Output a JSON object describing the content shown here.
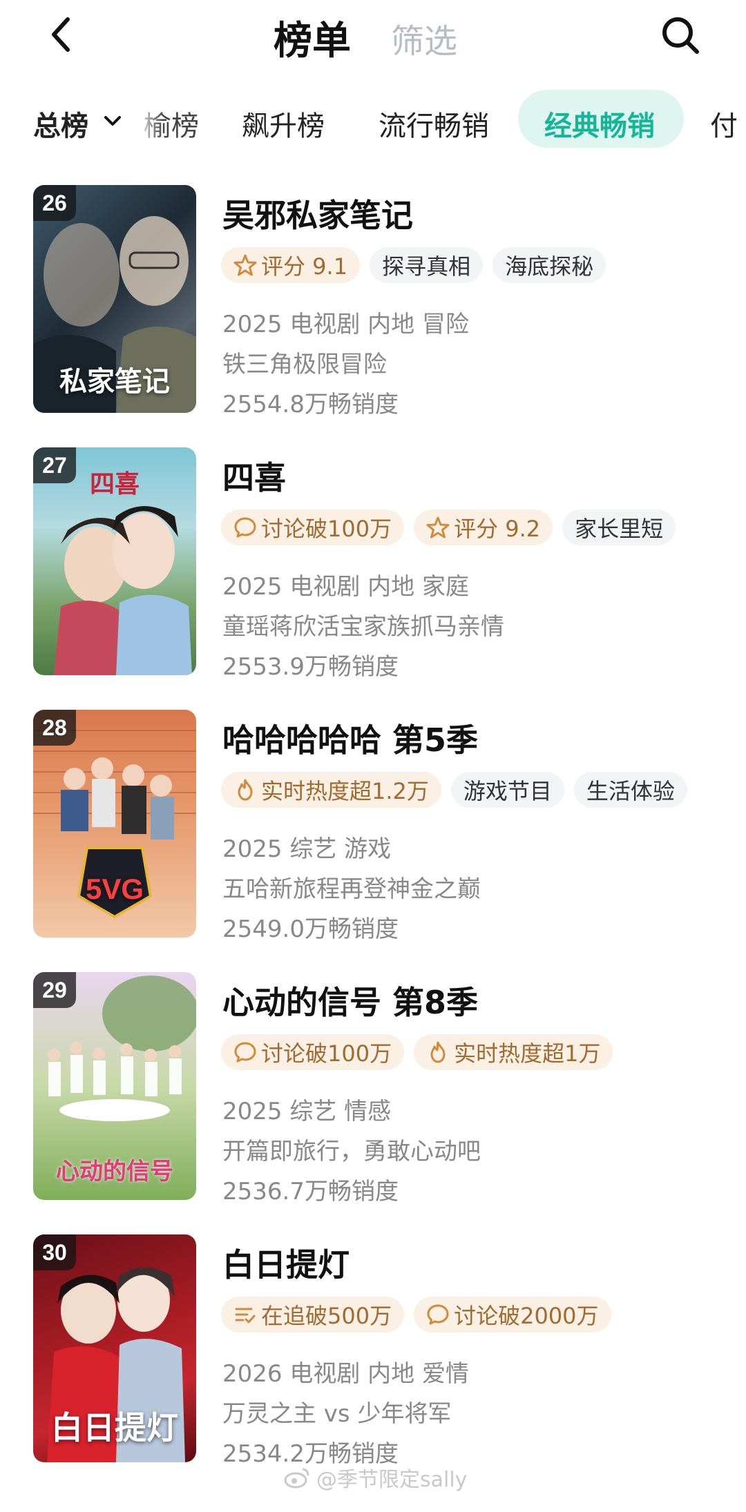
{
  "header": {
    "title": "榜单",
    "filter_label": "筛选"
  },
  "tabs": {
    "total_label": "总榜",
    "items": [
      "榆榜",
      "飙升榜",
      "流行畅销",
      "经典畅销",
      "付"
    ],
    "active_index": 3
  },
  "colors": {
    "accent": "#15b59a",
    "tag_highlight_bg": "#fbf0e4",
    "tag_highlight_text": "#a06a30"
  },
  "list": [
    {
      "rank": "26",
      "title": "吴邪私家笔记",
      "tags": [
        {
          "icon": "star-icon",
          "text": "评分 9.1",
          "style": "hl"
        },
        {
          "icon": "",
          "text": "探寻真相",
          "style": "gray"
        },
        {
          "icon": "",
          "text": "海底探秘",
          "style": "gray"
        }
      ],
      "meta": "2025 电视剧 内地 冒险",
      "desc": "铁三角极限冒险",
      "sales": "2554.8万畅销度",
      "poster_text": "私家笔记"
    },
    {
      "rank": "27",
      "title": "四喜",
      "tags": [
        {
          "icon": "comment-icon",
          "text": "讨论破100万",
          "style": "hl"
        },
        {
          "icon": "star-icon",
          "text": "评分 9.2",
          "style": "hl"
        },
        {
          "icon": "",
          "text": "家长里短",
          "style": "gray"
        }
      ],
      "meta": "2025 电视剧 内地 家庭",
      "desc": "童瑶蒋欣活宝家族抓马亲情",
      "sales": "2553.9万畅销度",
      "poster_text": "四喜"
    },
    {
      "rank": "28",
      "title": "哈哈哈哈哈 第5季",
      "tags": [
        {
          "icon": "flame-icon",
          "text": "实时热度超1.2万",
          "style": "hl"
        },
        {
          "icon": "",
          "text": "游戏节目",
          "style": "gray"
        },
        {
          "icon": "",
          "text": "生活体验",
          "style": "gray"
        }
      ],
      "meta": "2025 综艺 游戏",
      "desc": "五哈新旅程再登神金之巅",
      "sales": "2549.0万畅销度",
      "poster_text": "5VG"
    },
    {
      "rank": "29",
      "title": "心动的信号 第8季",
      "tags": [
        {
          "icon": "comment-icon",
          "text": "讨论破100万",
          "style": "hl"
        },
        {
          "icon": "flame-icon",
          "text": "实时热度超1万",
          "style": "hl"
        }
      ],
      "meta": "2025 综艺 情感",
      "desc": "开篇即旅行，勇敢心动吧",
      "sales": "2536.7万畅销度",
      "poster_text": "心动的信号"
    },
    {
      "rank": "30",
      "title": "白日提灯",
      "tags": [
        {
          "icon": "list-icon",
          "text": "在追破500万",
          "style": "hl"
        },
        {
          "icon": "comment-icon",
          "text": "讨论破2000万",
          "style": "hl"
        }
      ],
      "meta": "2026 电视剧 内地 爱情",
      "desc": "万灵之主 vs 少年将军",
      "sales": "2534.2万畅销度",
      "poster_text": "白日提灯"
    }
  ],
  "watermark": "@季节限定sally"
}
